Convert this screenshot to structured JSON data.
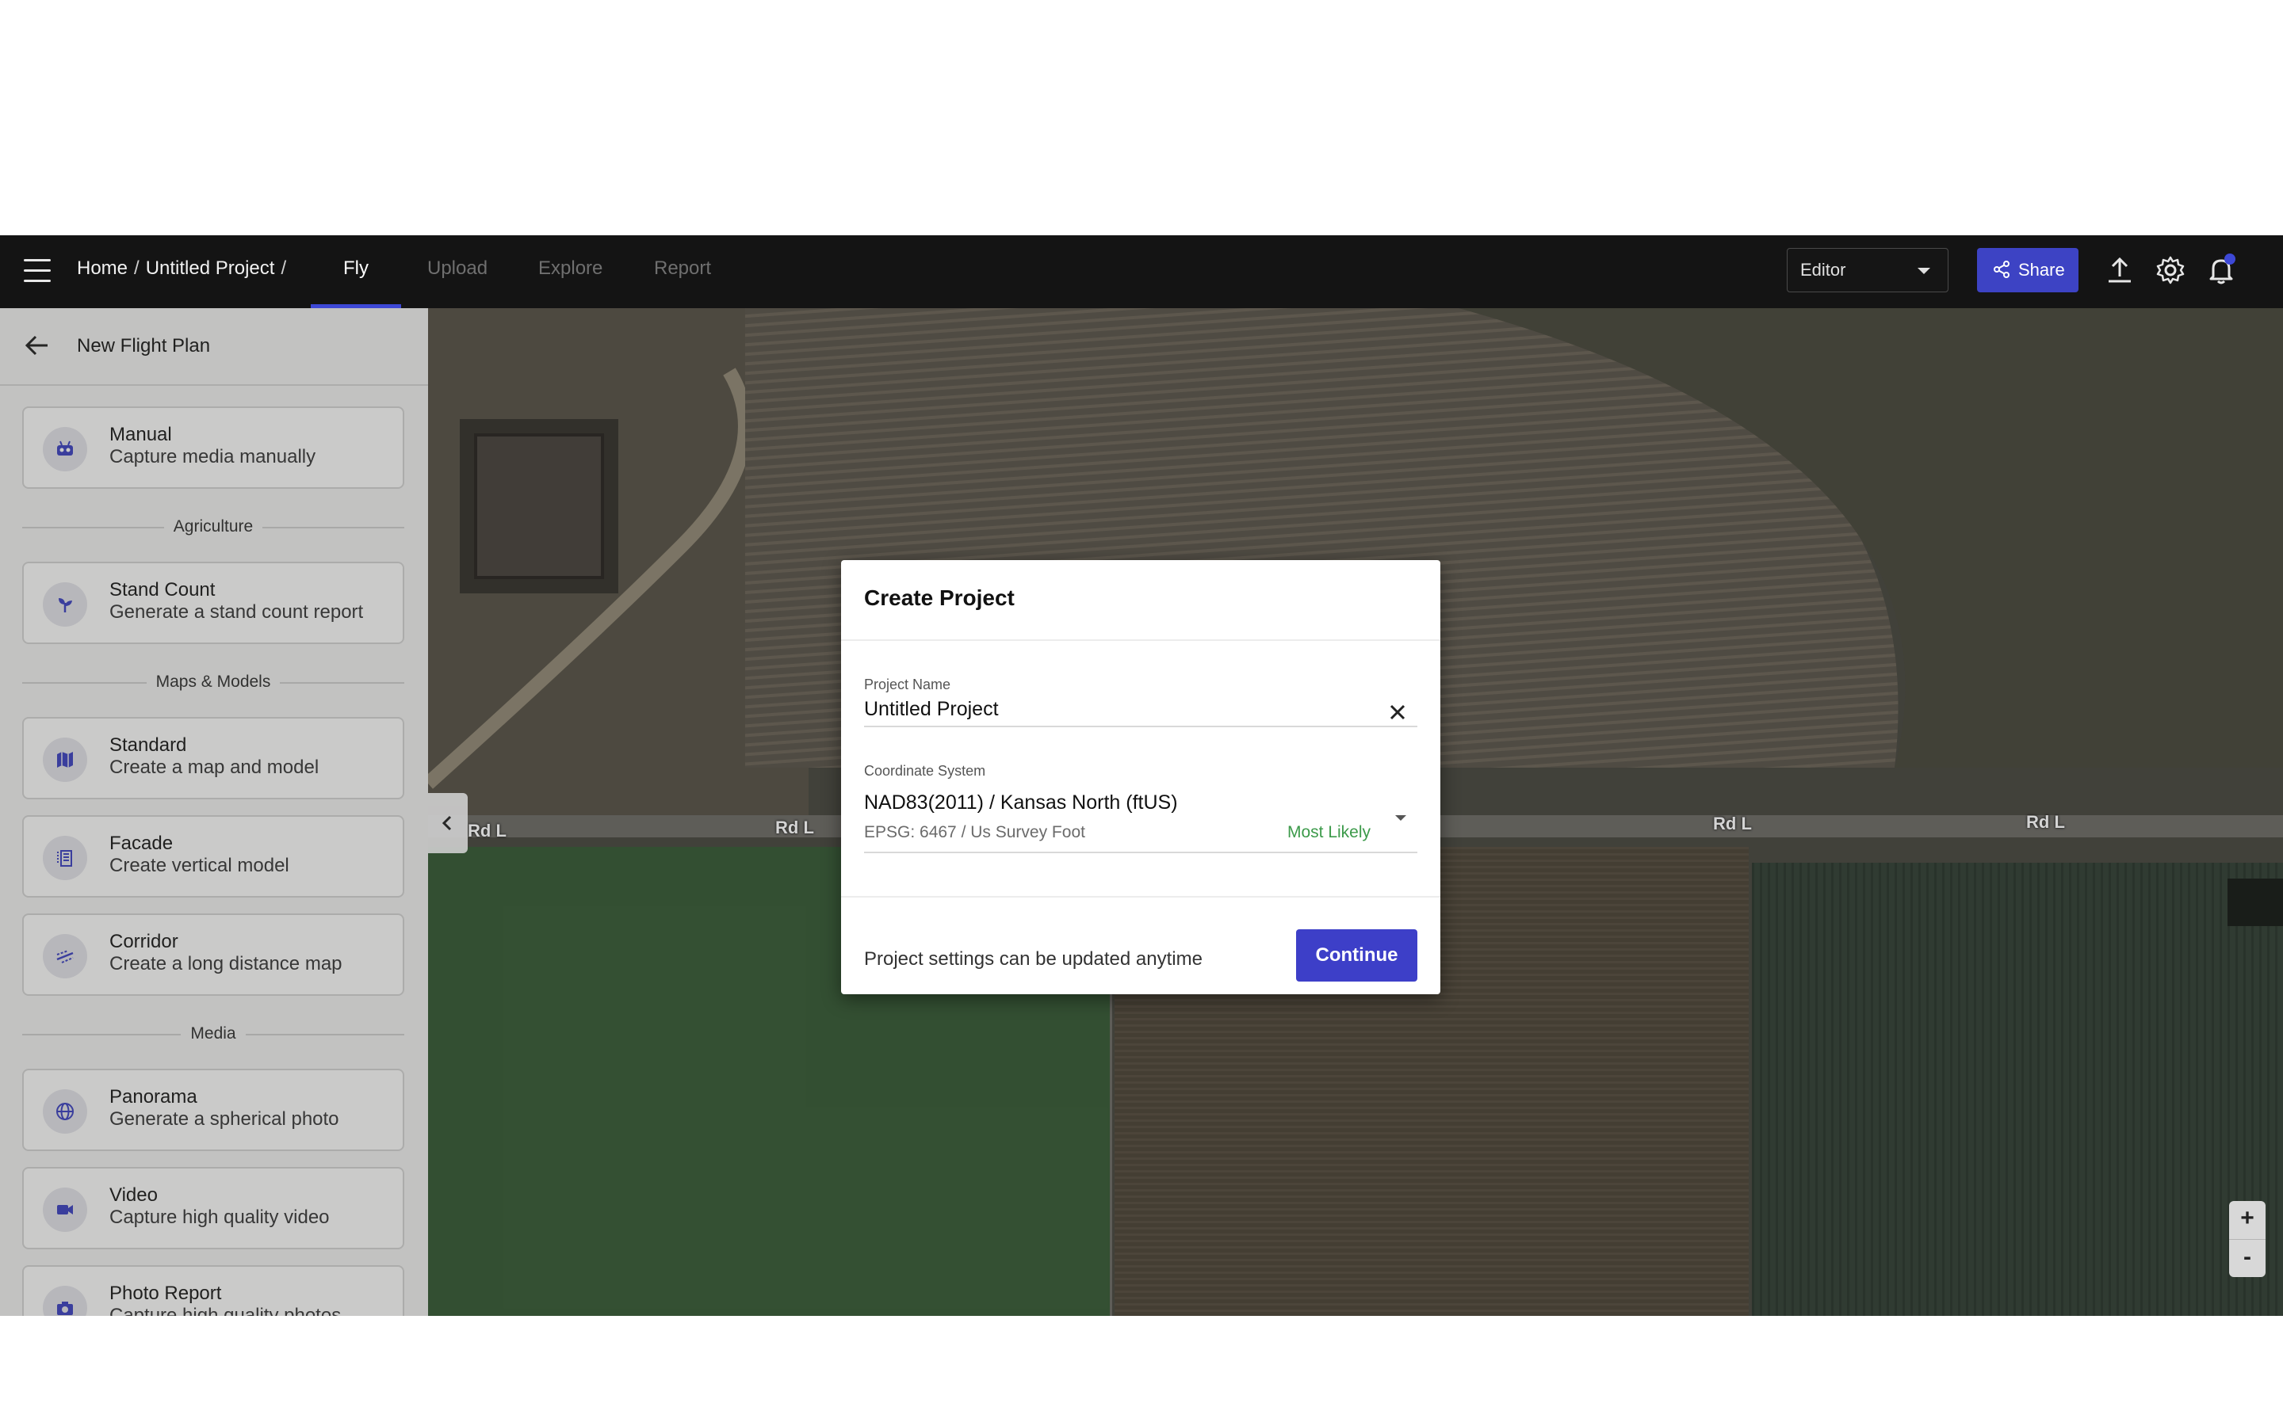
{
  "topbar": {
    "breadcrumb_home": "Home",
    "breadcrumb_sep": "/",
    "breadcrumb_project": "Untitled Project",
    "breadcrumb_trailing": "/",
    "tabs": [
      {
        "label": "Fly",
        "active": true
      },
      {
        "label": "Upload",
        "active": false
      },
      {
        "label": "Explore",
        "active": false
      },
      {
        "label": "Report",
        "active": false
      }
    ],
    "role_value": "Editor",
    "share_label": "Share"
  },
  "sidebar": {
    "title": "New Flight Plan",
    "manual": {
      "title": "Manual",
      "subtitle": "Capture media manually",
      "icon": "drone-controller-icon"
    },
    "sections": {
      "agriculture": "Agriculture",
      "maps_models": "Maps & Models",
      "media": "Media"
    },
    "stand_count": {
      "title": "Stand Count",
      "subtitle": "Generate a stand count report",
      "icon": "sprout-icon"
    },
    "standard": {
      "title": "Standard",
      "subtitle": "Create a map and model",
      "icon": "map-icon"
    },
    "facade": {
      "title": "Facade",
      "subtitle": "Create vertical model",
      "icon": "building-icon"
    },
    "corridor": {
      "title": "Corridor",
      "subtitle": "Create a long distance map",
      "icon": "corridor-icon"
    },
    "panorama": {
      "title": "Panorama",
      "subtitle": "Generate a spherical photo",
      "icon": "globe-icon"
    },
    "video": {
      "title": "Video",
      "subtitle": "Capture high quality video",
      "icon": "video-camera-icon"
    },
    "photo_report": {
      "title": "Photo Report",
      "subtitle": "Capture high quality photos",
      "icon": "camera-icon"
    }
  },
  "map": {
    "road_labels": [
      "Rd L",
      "Rd L",
      "Rd L",
      "Rd L"
    ],
    "zoom_in": "+",
    "zoom_out": "-"
  },
  "modal": {
    "title": "Create Project",
    "project_name_label": "Project Name",
    "project_name_value": "Untitled Project",
    "coordinate_label": "Coordinate System",
    "coordinate_value": "NAD83(2011) / Kansas North (ftUS)",
    "coordinate_sub": "EPSG: 6467 / Us Survey Foot",
    "coordinate_badge": "Most Likely",
    "footer_text": "Project settings can be updated anytime",
    "continue_label": "Continue"
  },
  "colors": {
    "accent": "#3d43c4",
    "topbar": "#141414",
    "likely_green": "#3c9a4a"
  }
}
